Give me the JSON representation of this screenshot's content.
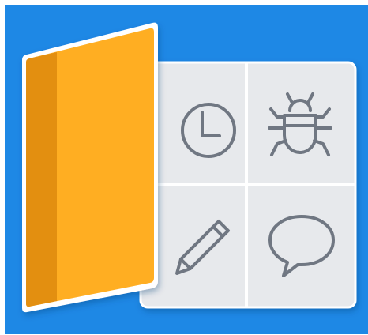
{
  "icon_tile": {
    "name": "feature-panel-logo",
    "colors": {
      "background": "#1e88e5",
      "card": "#e7e9ec",
      "divider": "#ffffff",
      "door_front": "#ffae22",
      "door_spine": "#e38f10",
      "door_border": "#ffffff",
      "glyph_stroke": "#707782"
    },
    "cells": [
      {
        "icon": "clock-icon"
      },
      {
        "icon": "bug-icon"
      },
      {
        "icon": "pencil-icon"
      },
      {
        "icon": "speech-bubble-icon"
      }
    ]
  }
}
